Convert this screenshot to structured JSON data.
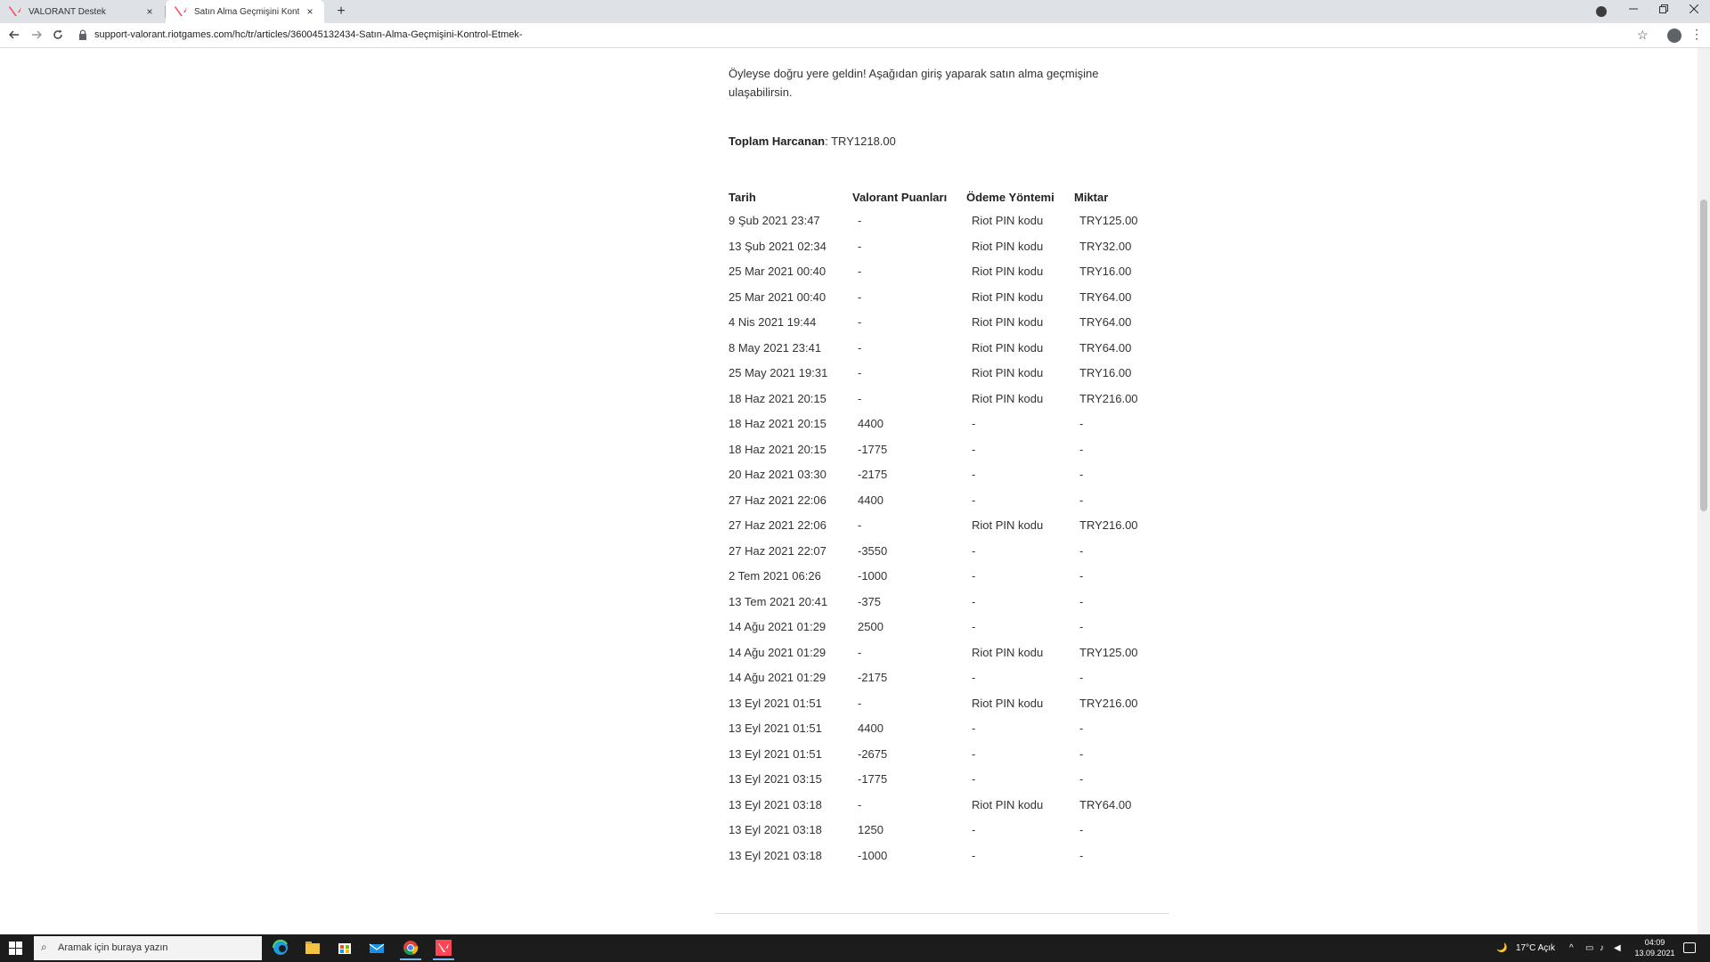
{
  "browser": {
    "tabs": [
      {
        "title": "VALORANT Destek",
        "active": false
      },
      {
        "title": "Satın Alma Geçmişini Kontrol Etmek",
        "active": true
      }
    ],
    "new_tab_symbol": "+",
    "close_symbol": "×",
    "url": "support-valorant.riotgames.com/hc/tr/articles/360045132434-Satın-Alma-Geçmişini-Kontrol-Etmek-",
    "icons": [
      "back-arrow-icon",
      "forward-arrow-icon",
      "reload-icon",
      "lock-icon",
      "bookmark-star-icon",
      "account-icon",
      "menu-dots-icon"
    ]
  },
  "page": {
    "intro": "Öyleyse doğru yere geldin! Aşağıdan giriş yaparak satın alma geçmişine ulaşabilirsin.",
    "total_label": "Toplam Harcanan",
    "total_value": ": TRY1218.00",
    "table": {
      "headers": [
        "Tarih",
        "Valorant Puanları",
        "Ödeme Yöntemi",
        "Miktar"
      ],
      "rows": [
        [
          "9 Şub 2021 23:47",
          "-",
          "Riot PIN kodu",
          "TRY125.00"
        ],
        [
          "13 Şub 2021 02:34",
          "-",
          "Riot PIN kodu",
          "TRY32.00"
        ],
        [
          "25 Mar 2021 00:40",
          "-",
          "Riot PIN kodu",
          "TRY16.00"
        ],
        [
          "25 Mar 2021 00:40",
          "-",
          "Riot PIN kodu",
          "TRY64.00"
        ],
        [
          "4 Nis 2021 19:44",
          "-",
          "Riot PIN kodu",
          "TRY64.00"
        ],
        [
          "8 May 2021 23:41",
          "-",
          "Riot PIN kodu",
          "TRY64.00"
        ],
        [
          "25 May 2021 19:31",
          "-",
          "Riot PIN kodu",
          "TRY16.00"
        ],
        [
          "18 Haz 2021 20:15",
          "-",
          "Riot PIN kodu",
          "TRY216.00"
        ],
        [
          "18 Haz 2021 20:15",
          "4400",
          "-",
          "-"
        ],
        [
          "18 Haz 2021 20:15",
          "-1775",
          "-",
          "-"
        ],
        [
          "20 Haz 2021 03:30",
          "-2175",
          "-",
          "-"
        ],
        [
          "27 Haz 2021 22:06",
          "4400",
          "-",
          "-"
        ],
        [
          "27 Haz 2021 22:06",
          "-",
          "Riot PIN kodu",
          "TRY216.00"
        ],
        [
          "27 Haz 2021 22:07",
          "-3550",
          "-",
          "-"
        ],
        [
          "2 Tem 2021 06:26",
          "-1000",
          "-",
          "-"
        ],
        [
          "13 Tem 2021 20:41",
          "-375",
          "-",
          "-"
        ],
        [
          "14 Ağu 2021 01:29",
          "2500",
          "-",
          "-"
        ],
        [
          "14 Ağu 2021 01:29",
          "-",
          "Riot PIN kodu",
          "TRY125.00"
        ],
        [
          "14 Ağu 2021 01:29",
          "-2175",
          "-",
          "-"
        ],
        [
          "13 Eyl 2021 01:51",
          "-",
          "Riot PIN kodu",
          "TRY216.00"
        ],
        [
          "13 Eyl 2021 01:51",
          "4400",
          "-",
          "-"
        ],
        [
          "13 Eyl 2021 01:51",
          "-2675",
          "-",
          "-"
        ],
        [
          "13 Eyl 2021 03:15",
          "-1775",
          "-",
          "-"
        ],
        [
          "13 Eyl 2021 03:18",
          "-",
          "Riot PIN kodu",
          "TRY64.00"
        ],
        [
          "13 Eyl 2021 03:18",
          "1250",
          "-",
          "-"
        ],
        [
          "13 Eyl 2021 03:18",
          "-1000",
          "-",
          "-"
        ]
      ]
    }
  },
  "taskbar": {
    "search_placeholder": "Aramak için buraya yazın",
    "weather": "17°C  Açık",
    "time": "04:09",
    "date": "13.09.2021",
    "apps": [
      "edge-icon",
      "file-explorer-icon",
      "store-icon",
      "mail-icon",
      "chrome-icon",
      "valorant-icon"
    ]
  },
  "colors": {
    "valorant_red": "#ff4655",
    "tab_strip": "#dee1e6",
    "taskbar": "#1c1c1c"
  }
}
